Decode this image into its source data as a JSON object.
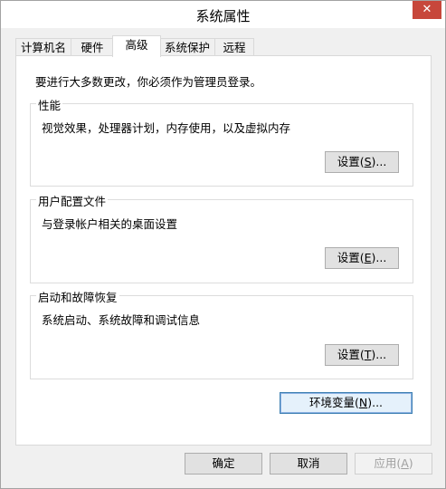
{
  "window": {
    "title": "系统属性",
    "close_label": "✕"
  },
  "tabs": [
    {
      "label": "计算机名"
    },
    {
      "label": "硬件"
    },
    {
      "label": "高级",
      "active": true
    },
    {
      "label": "系统保护"
    },
    {
      "label": "远程"
    }
  ],
  "notice": "要进行大多数更改，你必须作为管理员登录。",
  "groups": {
    "performance": {
      "title": "性能",
      "description": "视觉效果，处理器计划，内存使用，以及虚拟内存",
      "button_pre": "设置(",
      "button_key": "S",
      "button_post": ")..."
    },
    "user_profiles": {
      "title": "用户配置文件",
      "description": "与登录帐户相关的桌面设置",
      "button_pre": "设置(",
      "button_key": "E",
      "button_post": ")..."
    },
    "startup_recovery": {
      "title": "启动和故障恢复",
      "description": "系统启动、系统故障和调试信息",
      "button_pre": "设置(",
      "button_key": "T",
      "button_post": ")..."
    }
  },
  "env_button": {
    "pre": "环境变量(",
    "key": "N",
    "post": ")..."
  },
  "footer": {
    "ok": "确定",
    "cancel": "取消",
    "apply_pre": "应用(",
    "apply_key": "A",
    "apply_post": ")"
  },
  "colors": {
    "close_button": "#c7473b",
    "focus_border": "#3c7fb1"
  }
}
